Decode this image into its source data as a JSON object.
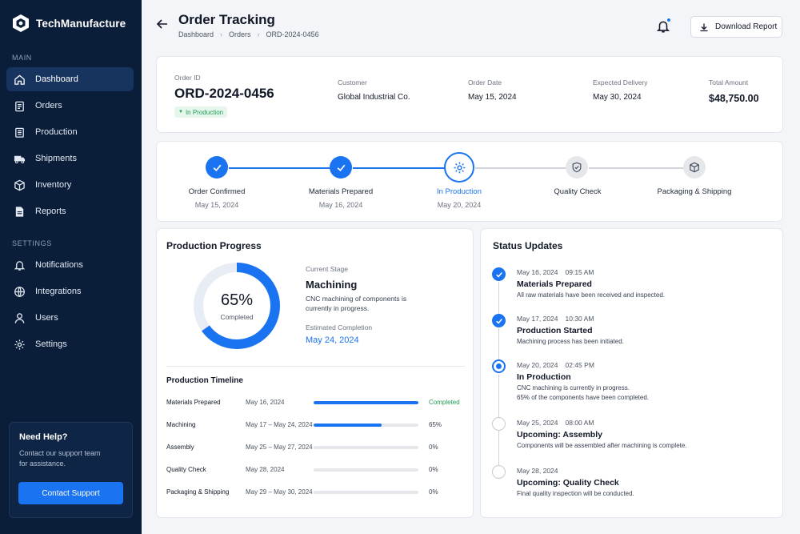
{
  "app": {
    "name": "TechManufacture"
  },
  "sidebar": {
    "main_label": "MAIN",
    "settings_label": "SETTINGS",
    "main_items": [
      {
        "label": "Dashboard",
        "icon": "home-icon",
        "active": true
      },
      {
        "label": "Orders",
        "icon": "clipboard-icon"
      },
      {
        "label": "Production",
        "icon": "factory-icon"
      },
      {
        "label": "Shipments",
        "icon": "truck-icon"
      },
      {
        "label": "Inventory",
        "icon": "box-icon"
      },
      {
        "label": "Reports",
        "icon": "document-icon"
      }
    ],
    "settings_items": [
      {
        "label": "Notifications",
        "icon": "bell-icon"
      },
      {
        "label": "Integrations",
        "icon": "globe-icon"
      },
      {
        "label": "Users",
        "icon": "user-icon"
      },
      {
        "label": "Settings",
        "icon": "gear-icon"
      }
    ],
    "help": {
      "title": "Need Help?",
      "text": "Contact our support team for assistance.",
      "button": "Contact Support"
    }
  },
  "header": {
    "title": "Order Tracking",
    "breadcrumb": [
      "Dashboard",
      "Orders",
      "ORD-2024-0456"
    ],
    "download_label": "Download Report"
  },
  "summary": {
    "order_id_label": "Order ID",
    "order_id": "ORD-2024-0456",
    "status": "In Production",
    "customer_label": "Customer",
    "customer": "Global Industrial Co.",
    "order_date_label": "Order Date",
    "order_date": "May 15, 2024",
    "expected_label": "Expected Delivery",
    "expected": "May 30, 2024",
    "total_label": "Total Amount",
    "total": "$48,750.00"
  },
  "stepper": {
    "steps": [
      {
        "name": "Order Confirmed",
        "date": "May 15, 2024",
        "state": "done"
      },
      {
        "name": "Materials Prepared",
        "date": "May 16, 2024",
        "state": "done"
      },
      {
        "name": "In Production",
        "date": "May 20, 2024",
        "state": "current"
      },
      {
        "name": "Quality Check",
        "date": "",
        "state": "pending"
      },
      {
        "name": "Packaging & Shipping",
        "date": "",
        "state": "pending"
      }
    ]
  },
  "progress": {
    "title": "Production Progress",
    "percent_value": 0.65,
    "percent_text": "65%",
    "completed_label": "Completed",
    "current_stage_label": "Current Stage",
    "current_stage": "Machining",
    "current_desc": "CNC machining of components is currently in progress.",
    "est_label": "Estimated Completion",
    "est_date": "May 24, 2024",
    "timeline_title": "Production Timeline",
    "timeline": [
      {
        "name": "Materials Prepared",
        "dates": "May 16, 2024",
        "progress": 1.0,
        "status": "Completed"
      },
      {
        "name": "Machining",
        "dates": "May 17 – May 24, 2024",
        "progress": 0.65,
        "status": "65%"
      },
      {
        "name": "Assembly",
        "dates": "May 25 – May 27, 2024",
        "progress": 0,
        "status": "0%"
      },
      {
        "name": "Quality Check",
        "dates": "May 28, 2024",
        "progress": 0,
        "status": "0%"
      },
      {
        "name": "Packaging & Shipping",
        "dates": "May 29 – May 30, 2024",
        "progress": 0,
        "status": "0%"
      }
    ]
  },
  "updates": {
    "title": "Status Updates",
    "items": [
      {
        "date": "May 16, 2024",
        "time": "09:15 AM",
        "title": "Materials Prepared",
        "desc": [
          "All raw materials have been received and inspected."
        ],
        "state": "done"
      },
      {
        "date": "May 17, 2024",
        "time": "10:30 AM",
        "title": "Production Started",
        "desc": [
          "Machining process has been initiated."
        ],
        "state": "done"
      },
      {
        "date": "May 20, 2024",
        "time": "02:45 PM",
        "title": "In Production",
        "desc": [
          "CNC machining is currently in progress.",
          "65% of the components have been completed."
        ],
        "state": "current"
      },
      {
        "date": "May 25, 2024",
        "time": "08:00 AM",
        "title": "Upcoming: Assembly",
        "desc": [
          "Components will be assembled after machining is complete."
        ],
        "state": "pending"
      },
      {
        "date": "May 28, 2024",
        "time": "",
        "title": "Upcoming: Quality Check",
        "desc": [
          "Final quality inspection will be conducted."
        ],
        "state": "pending"
      }
    ]
  },
  "colors": {
    "accent": "#1a73f0",
    "success": "#1f9d55",
    "sidebar": "#0a1e3a"
  }
}
